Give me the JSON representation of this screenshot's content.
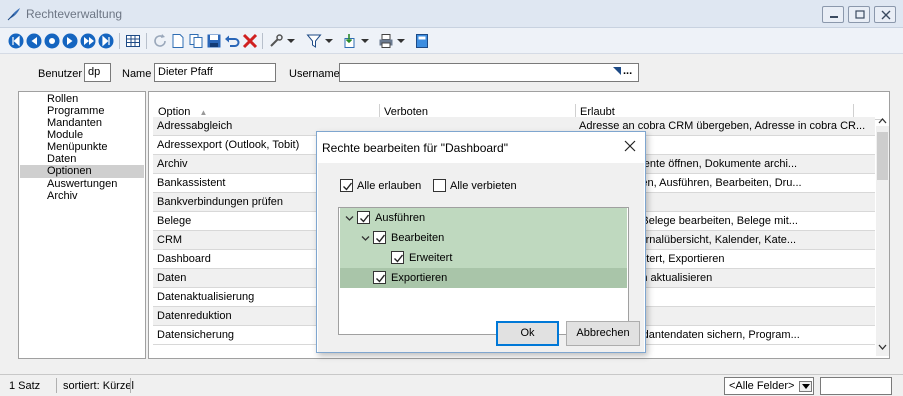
{
  "window": {
    "title": "Rechteverwaltung"
  },
  "filter": {
    "benutzer_label": "Benutzer",
    "benutzer_value": "dp",
    "name_label": "Name",
    "name_value": "Dieter Pfaff",
    "username_label": "Username",
    "username_value": "",
    "browse_label": "..."
  },
  "left_list": {
    "items": [
      {
        "label": "Rollen",
        "selected": false
      },
      {
        "label": "Programme",
        "selected": false
      },
      {
        "label": "Mandanten",
        "selected": false
      },
      {
        "label": "Module",
        "selected": false
      },
      {
        "label": "Menüpunkte",
        "selected": false
      },
      {
        "label": "Daten",
        "selected": false
      },
      {
        "label": "Optionen",
        "selected": true
      },
      {
        "label": "Auswertungen",
        "selected": false
      },
      {
        "label": "Archiv",
        "selected": false
      }
    ]
  },
  "grid": {
    "columns": [
      "Option",
      "Verboten",
      "Erlaubt"
    ],
    "sort_indicator": "▲",
    "rows": [
      {
        "option": "Adressabgleich",
        "verboten": "",
        "erlaubt": "Adresse an cobra CRM übergeben, Adresse in cobra CR..."
      },
      {
        "option": "Adressexport (Outlook, Tobit)",
        "verboten": "",
        "erlaubt": ""
      },
      {
        "option": "Archiv",
        "verboten": "",
        "erlaubt": "vierte Dokumente öffnen, Dokumente archi..."
      },
      {
        "option": "Bankassistent",
        "verboten": "",
        "erlaubt": "ereinstellungen, Ausführen, Bearbeiten, Dru..."
      },
      {
        "option": "Bankverbindungen prüfen",
        "verboten": "",
        "erlaubt": ""
      },
      {
        "option": "Belege",
        "verboten": "",
        "erlaubt": "egdefinition, Belege bearbeiten, Belege mit..."
      },
      {
        "option": "CRM",
        "verboten": "",
        "erlaubt": ", E-Mails, Journalübersicht, Kalender, Kate..."
      },
      {
        "option": "Dashboard",
        "verboten": "",
        "erlaubt": "rbeiten, Erweitert, Exportieren"
      },
      {
        "option": "Daten",
        "verboten": "",
        "erlaubt": ", Stammdaten aktualisieren"
      },
      {
        "option": "Datenaktualisierung",
        "verboten": "",
        "erlaubt": ""
      },
      {
        "option": "Datenreduktion",
        "verboten": "",
        "erlaubt": ""
      },
      {
        "option": "Datensicherung",
        "verboten": "",
        "erlaubt": "g laden, Mandantendaten sichern, Program..."
      }
    ]
  },
  "statusbar": {
    "count": "1 Satz",
    "sort": "sortiert: Kürzel",
    "field_select": "<Alle Felder>"
  },
  "dialog": {
    "title": "Rechte bearbeiten für \"Dashboard\"",
    "allow_all": "Alle erlauben",
    "deny_all": "Alle verbieten",
    "tree": [
      {
        "label": "Ausführen",
        "level": 0,
        "expandable": true,
        "checked": true
      },
      {
        "label": "Bearbeiten",
        "level": 1,
        "expandable": true,
        "checked": true
      },
      {
        "label": "Erweitert",
        "level": 2,
        "expandable": false,
        "checked": true
      },
      {
        "label": "Exportieren",
        "level": 1,
        "expandable": false,
        "checked": true
      }
    ],
    "ok_label": "Ok",
    "cancel_label": "Abbrechen"
  },
  "colors": {
    "titlebar": "#dfe7f2",
    "selection": "#cfcfcf",
    "tree_green": "#bfd9bf",
    "tree_green_dark": "#a9c5a9",
    "accent_blue": "#0078d7"
  }
}
